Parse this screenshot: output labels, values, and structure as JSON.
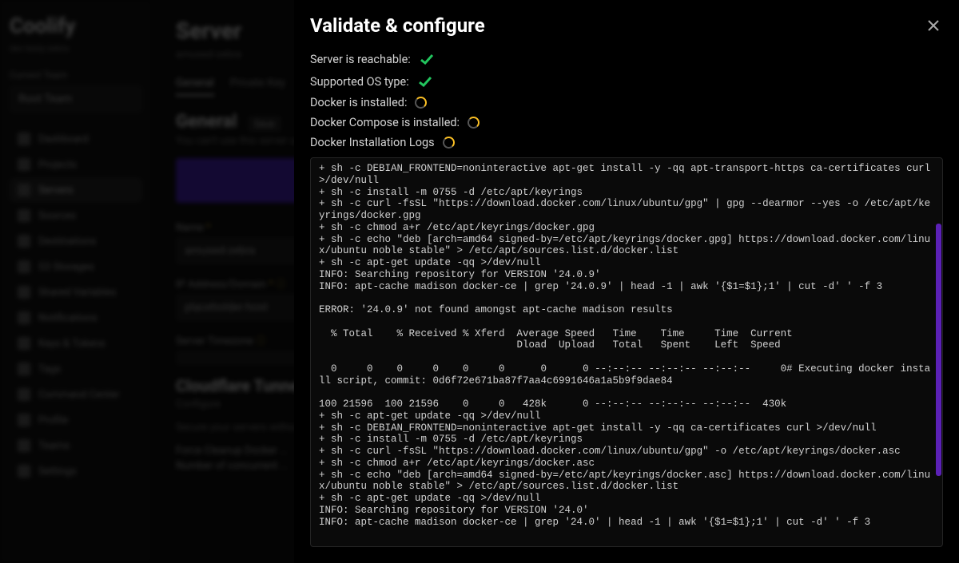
{
  "brand": "Coolify",
  "brand_sub": "dev-testy-zebra",
  "sidebar": {
    "team_label": "Current Team",
    "team_value": "Root Team",
    "items": [
      {
        "label": "Dashboard"
      },
      {
        "label": "Projects"
      },
      {
        "label": "Servers"
      },
      {
        "label": "Sources"
      },
      {
        "label": "Destinations"
      },
      {
        "label": "S3 Storages"
      },
      {
        "label": "Shared Variables"
      },
      {
        "label": "Notifications"
      },
      {
        "label": "Keys & Tokens"
      },
      {
        "label": "Tags"
      },
      {
        "label": "Command Center"
      },
      {
        "label": "Profile"
      },
      {
        "label": "Teams"
      },
      {
        "label": "Settings"
      }
    ]
  },
  "page": {
    "title": "Server",
    "subtitle": "amused-zebra",
    "tabs": [
      {
        "label": "General",
        "active": true
      },
      {
        "label": "Private Key"
      }
    ],
    "section_title": "General",
    "save_label": "Save",
    "section_sub": "You can't use this server until validated.",
    "name_label": "Name",
    "name_value": "amused-zebra",
    "ip_label": "IP Address/Domain",
    "ip_value": "placeholder-host",
    "tz_label": "Server Timezone",
    "cf_title": "Cloudflare Tunnel",
    "cf_sub": "Configure",
    "cleanup_label": "Force Cleanup Docker ...",
    "concurrent_label": "Number of concurrent ..."
  },
  "modal": {
    "title": "Validate & configure",
    "checks": [
      {
        "label": "Server is reachable:",
        "status": "success"
      },
      {
        "label": "Supported OS type:",
        "status": "success"
      },
      {
        "label": "Docker is installed:",
        "status": "loading"
      },
      {
        "label": "Docker Compose is installed:",
        "status": "loading"
      },
      {
        "label": "Docker Installation Logs",
        "status": "loading"
      }
    ],
    "logs": "+ sh -c DEBIAN_FRONTEND=noninteractive apt-get install -y -qq apt-transport-https ca-certificates curl >/dev/null\n+ sh -c install -m 0755 -d /etc/apt/keyrings\n+ sh -c curl -fsSL \"https://download.docker.com/linux/ubuntu/gpg\" | gpg --dearmor --yes -o /etc/apt/keyrings/docker.gpg\n+ sh -c chmod a+r /etc/apt/keyrings/docker.gpg\n+ sh -c echo \"deb [arch=amd64 signed-by=/etc/apt/keyrings/docker.gpg] https://download.docker.com/linux/ubuntu noble stable\" > /etc/apt/sources.list.d/docker.list\n+ sh -c apt-get update -qq >/dev/null\nINFO: Searching repository for VERSION '24.0.9'\nINFO: apt-cache madison docker-ce | grep '24.0.9' | head -1 | awk '{$1=$1};1' | cut -d' ' -f 3\n\nERROR: '24.0.9' not found amongst apt-cache madison results\n\n  % Total    % Received % Xferd  Average Speed   Time    Time     Time  Current\n                                 Dload  Upload   Total   Spent    Left  Speed\n\n  0     0    0     0    0     0      0      0 --:--:-- --:--:-- --:--:--     0# Executing docker install script, commit: 0d6f72e671ba87f7aa4c6991646a1a5b9f9dae84\n\n100 21596  100 21596    0     0   428k      0 --:--:-- --:--:-- --:--:--  430k\n+ sh -c apt-get update -qq >/dev/null\n+ sh -c DEBIAN_FRONTEND=noninteractive apt-get install -y -qq ca-certificates curl >/dev/null\n+ sh -c install -m 0755 -d /etc/apt/keyrings\n+ sh -c curl -fsSL \"https://download.docker.com/linux/ubuntu/gpg\" -o /etc/apt/keyrings/docker.asc\n+ sh -c chmod a+r /etc/apt/keyrings/docker.asc\n+ sh -c echo \"deb [arch=amd64 signed-by=/etc/apt/keyrings/docker.asc] https://download.docker.com/linux/ubuntu noble stable\" > /etc/apt/sources.list.d/docker.list\n+ sh -c apt-get update -qq >/dev/null\nINFO: Searching repository for VERSION '24.0'\nINFO: apt-cache madison docker-ce | grep '24.0' | head -1 | awk '{$1=$1};1' | cut -d' ' -f 3"
  }
}
